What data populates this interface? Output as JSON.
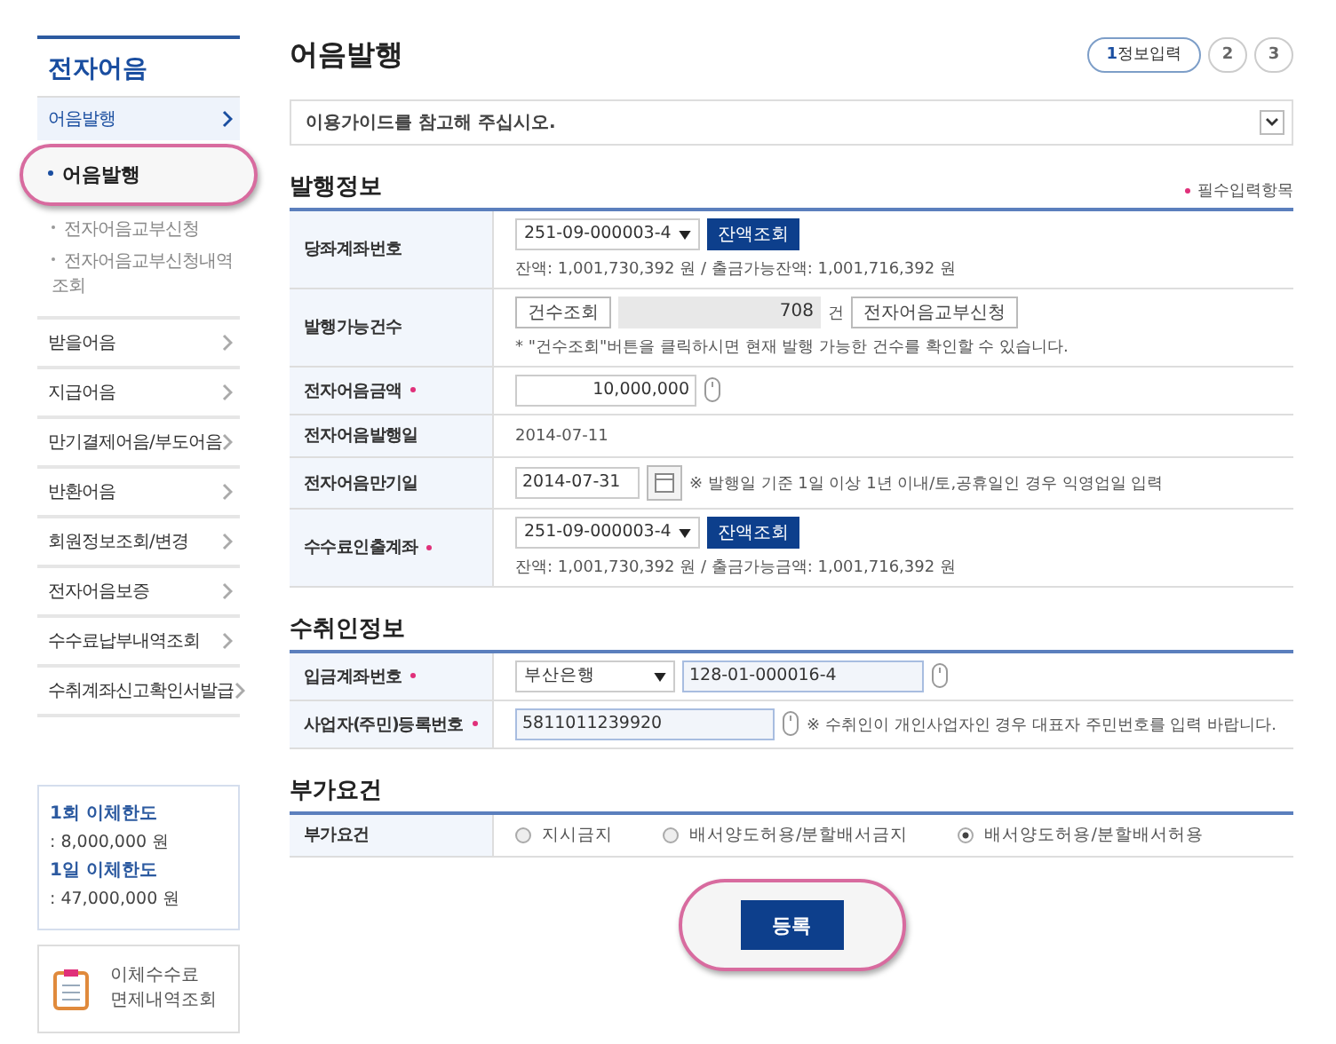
{
  "sidebar": {
    "title": "전자어음",
    "menu": [
      {
        "label": "어음발행",
        "expanded": true,
        "children": [
          {
            "label": "어음발행",
            "selected": true
          },
          {
            "label": "전자어음교부신청",
            "selected": false
          },
          {
            "label": "전자어음교부신청내역조회",
            "selected": false
          }
        ]
      },
      {
        "label": "받을어음",
        "expanded": false
      },
      {
        "label": "지급어음",
        "expanded": false
      },
      {
        "label": "만기결제어음/부도어음",
        "expanded": false
      },
      {
        "label": "반환어음",
        "expanded": false
      },
      {
        "label": "회원정보조회/변경",
        "expanded": false
      },
      {
        "label": "전자어음보증",
        "expanded": false
      },
      {
        "label": "수수료납부내역조회",
        "expanded": false
      },
      {
        "label": "수취계좌신고확인서발급",
        "expanded": false
      }
    ],
    "limits": [
      {
        "label": "1회 이체한도",
        "value": ": 8,000,000 원"
      },
      {
        "label": "1일 이체한도",
        "value": ": 47,000,000 원"
      }
    ],
    "fee_link": "이체수수료 면제내역조회"
  },
  "title": "어음발행",
  "steps": [
    {
      "number": "1",
      "label": "정보입력",
      "selected": true
    },
    {
      "number": "2",
      "selected": false
    },
    {
      "number": "3",
      "selected": false
    }
  ],
  "guide": "이용가이드를 참고해 주십시오.",
  "required_note": "필수입력항목",
  "sections": [
    {
      "title": "발행정보",
      "rows": [
        {
          "kind": "account",
          "label": "당좌계좌번호",
          "required": false,
          "select": "251-09-000003-4",
          "button": "잔액조회",
          "note": "잔액: 1,001,730,392 원 / 출금가능잔액: 1,001,716,392 원"
        },
        {
          "kind": "count",
          "label": "발행가능건수",
          "required": false,
          "button": "건수조회",
          "value": "708",
          "unit": "건",
          "button2": "전자어음교부신청",
          "note": "* \"건수조회\"버튼을 클릭하시면 현재 발행 가능한 건수를 확인할 수 있습니다."
        },
        {
          "kind": "amount",
          "label": "전자어음금액",
          "required": true,
          "value": "10,000,000"
        },
        {
          "kind": "text",
          "label": "전자어음발행일",
          "required": false,
          "value": "2014-07-11"
        },
        {
          "kind": "date",
          "label": "전자어음만기일",
          "required": false,
          "value": "2014-07-31",
          "note": "※ 발행일 기준 1일 이상 1년 이내/토,공휴일인 경우 익영업일 입력"
        },
        {
          "kind": "account",
          "label": "수수료인출계좌",
          "required": true,
          "select": "251-09-000003-4",
          "button": "잔액조회",
          "note": "잔액: 1,001,730,392 원 / 출금가능금액: 1,001,716,392 원"
        }
      ]
    },
    {
      "title": "수취인정보",
      "rows": [
        {
          "kind": "bank",
          "label": "입금계좌번호",
          "required": true,
          "select": "부산은행",
          "value": "128-01-000016-4"
        },
        {
          "kind": "id",
          "label": "사업자(주민)등록번호",
          "required": true,
          "value": "5811011239920",
          "note": "※ 수취인이 개인사업자인 경우 대표자 주민번호를 입력 바랍니다."
        }
      ]
    },
    {
      "title": "부가요건",
      "rows": [
        {
          "kind": "radios",
          "label": "부가요건",
          "required": false,
          "options": [
            {
              "label": "지시금지",
              "selected": false
            },
            {
              "label": "배서양도허용/분할배서금지",
              "selected": false
            },
            {
              "label": "배서양도허용/분할배서허용",
              "selected": true
            }
          ]
        }
      ]
    }
  ],
  "submit": "등록"
}
